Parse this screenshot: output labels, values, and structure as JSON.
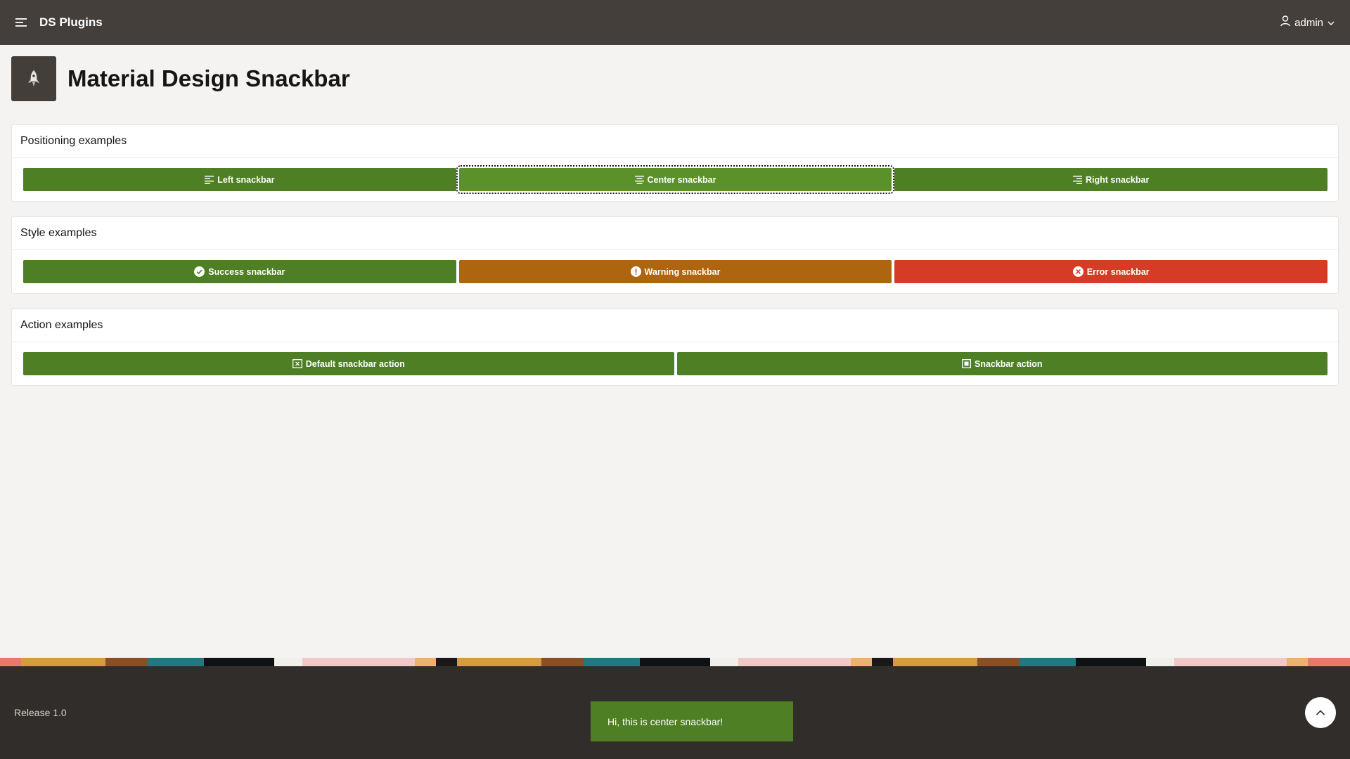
{
  "header": {
    "app_title": "DS Plugins",
    "menu_icon": "hamburger-icon",
    "user_icon": "user-icon",
    "user_name": "admin"
  },
  "page": {
    "title": "Material Design Snackbar",
    "icon": "rocket-icon"
  },
  "regions": [
    {
      "title": "Positioning examples",
      "buttons": [
        {
          "label": "Left snackbar",
          "icon": "align-left-icon",
          "color": "#4e7f25"
        },
        {
          "label": "Center snackbar",
          "icon": "align-center-icon",
          "color": "#5a9128",
          "focused": true
        },
        {
          "label": "Right snackbar",
          "icon": "align-right-icon",
          "color": "#4e7f25"
        }
      ]
    },
    {
      "title": "Style examples",
      "buttons": [
        {
          "label": "Success snackbar",
          "icon": "check-circle-icon",
          "color": "#4e7f25"
        },
        {
          "label": "Warning snackbar",
          "icon": "exclamation-circle-icon",
          "color": "#ad650f"
        },
        {
          "label": "Error snackbar",
          "icon": "x-circle-icon",
          "color": "#d63b25"
        }
      ]
    },
    {
      "title": "Action examples",
      "buttons": [
        {
          "label": "Default snackbar action",
          "icon": "close-square-icon",
          "color": "#4e7f25"
        },
        {
          "label": "Snackbar action",
          "icon": "square-icon",
          "color": "#4e7f25"
        }
      ]
    }
  ],
  "footer": {
    "release": "Release 1.0",
    "snackbar_message": "Hi, this is center snackbar!",
    "back_to_top_icon": "chevron-up-icon"
  },
  "colors": {
    "header_bg": "#443f3b",
    "footer_bg": "#312d2a",
    "primary_green": "#4e7f25",
    "warning": "#ad650f",
    "danger": "#d63b25"
  }
}
